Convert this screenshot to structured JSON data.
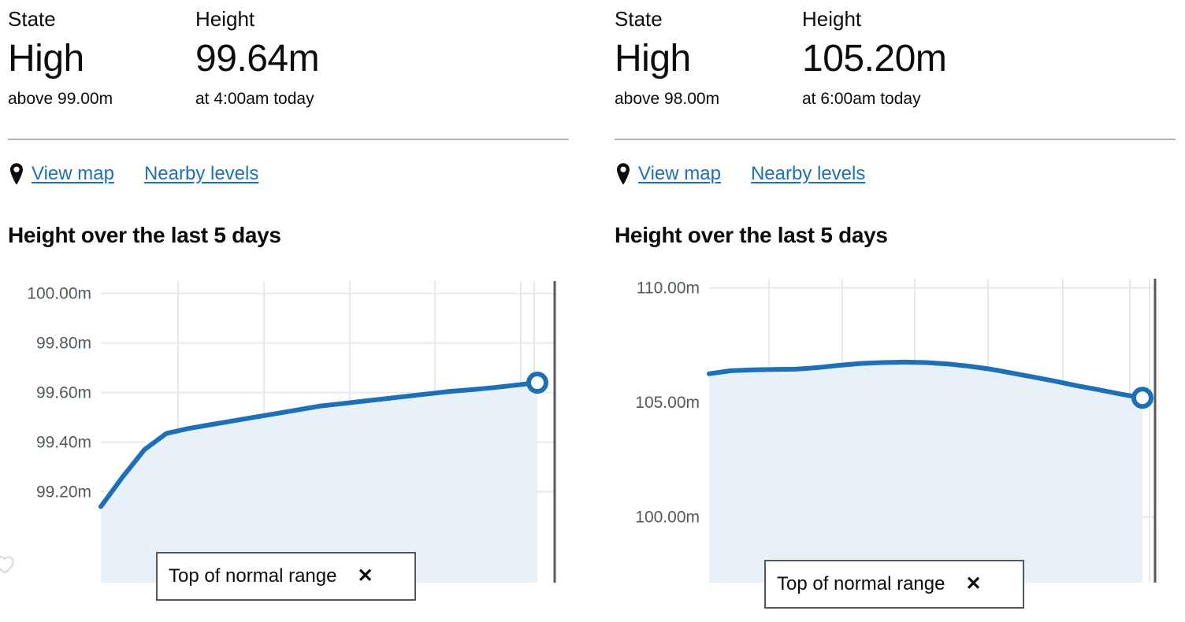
{
  "panels": [
    {
      "state": {
        "label": "State",
        "value": "High",
        "sub": "above 99.00m"
      },
      "height": {
        "label": "Height",
        "value": "99.64m",
        "sub": "at 4:00am today"
      },
      "links": {
        "pin_icon": "map-pin-icon",
        "view_map": "View map",
        "nearby_levels": "Nearby levels"
      },
      "chart_title": "Height over the last 5 days",
      "tooltip": {
        "text": "Top of normal range",
        "close_icon": "✕"
      },
      "favourite_icon": "heart-outline-icon"
    },
    {
      "state": {
        "label": "State",
        "value": "High",
        "sub": "above 98.00m"
      },
      "height": {
        "label": "Height",
        "value": "105.20m",
        "sub": "at 6:00am today"
      },
      "links": {
        "pin_icon": "map-pin-icon",
        "view_map": "View map",
        "nearby_levels": "Nearby levels"
      },
      "chart_title": "Height over the last 5 days",
      "tooltip": {
        "text": "Top of normal range",
        "close_icon": "✕"
      }
    }
  ],
  "colors": {
    "line": "#1d70b8",
    "fill": "#e8f0f8",
    "grid": "#e8eaec",
    "axis": "#505a5f",
    "link": "#1d70b8",
    "text": "#0b0c0c",
    "muted": "#505a5f",
    "divider": "#b1b4b6"
  },
  "chart_data": [
    {
      "type": "area",
      "title": "Height over the last 5 days",
      "xlabel": "",
      "ylabel": "",
      "ylim": [
        99.1,
        100.05
      ],
      "yticks": [
        "100.00m",
        "99.80m",
        "99.60m",
        "99.40m",
        "99.20m"
      ],
      "ytick_values": [
        100.0,
        99.8,
        99.6,
        99.4,
        99.2
      ],
      "grid": true,
      "legend": "Top of normal range",
      "current_marker": {
        "label": "99.64m",
        "value": 99.64
      },
      "x": [
        0,
        0.05,
        0.1,
        0.15,
        0.2,
        0.25,
        0.3,
        0.35,
        0.4,
        0.45,
        0.5,
        0.55,
        0.6,
        0.65,
        0.7,
        0.75,
        0.8,
        0.85,
        0.9,
        0.95,
        1.0
      ],
      "values": [
        99.14,
        99.26,
        99.37,
        99.435,
        99.455,
        99.47,
        99.485,
        99.5,
        99.515,
        99.53,
        99.545,
        99.555,
        99.565,
        99.575,
        99.585,
        99.595,
        99.605,
        99.612,
        99.62,
        99.63,
        99.64
      ]
    },
    {
      "type": "area",
      "title": "Height over the last 5 days",
      "xlabel": "",
      "ylabel": "",
      "ylim": [
        99.4,
        110.4
      ],
      "yticks": [
        "110.00m",
        "105.00m",
        "100.00m"
      ],
      "ytick_values": [
        110.0,
        105.0,
        100.0
      ],
      "grid": true,
      "legend": "Top of normal range",
      "current_marker": {
        "label": "105.20m",
        "value": 105.2
      },
      "x": [
        0,
        0.05,
        0.1,
        0.15,
        0.2,
        0.25,
        0.3,
        0.35,
        0.4,
        0.45,
        0.5,
        0.55,
        0.6,
        0.65,
        0.7,
        0.75,
        0.8,
        0.85,
        0.9,
        0.95,
        1.0
      ],
      "values": [
        106.25,
        106.38,
        106.42,
        106.44,
        106.45,
        106.52,
        106.62,
        106.7,
        106.74,
        106.76,
        106.74,
        106.68,
        106.58,
        106.45,
        106.28,
        106.1,
        105.92,
        105.72,
        105.55,
        105.36,
        105.2
      ]
    }
  ]
}
